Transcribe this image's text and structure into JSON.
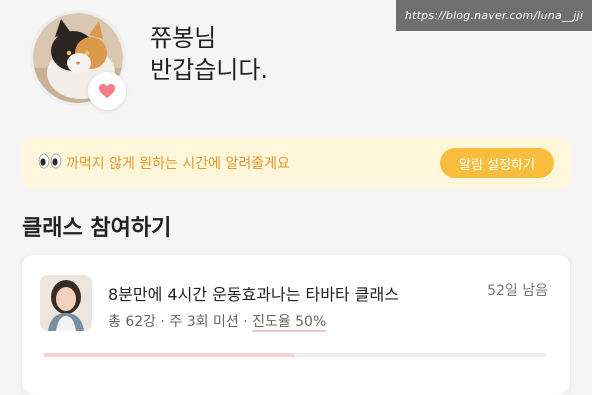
{
  "watermark": "https://blog.naver.com/luna__jji",
  "greeting": {
    "name_line": "쮸봉님",
    "hello_line": "반갑습니다."
  },
  "notice": {
    "text": "까먹지 않게 원하는 시간에 알려줄게요",
    "button_label": "알림 설정하기",
    "icon": "eyes-emoji"
  },
  "section_title": "클래스 참여하기",
  "class_card": {
    "title": "8분만에 4시간 운동효과나는 타바타  클래스",
    "days_left": "52일 남음",
    "meta_prefix": "총 62강 · 주 3회 미션 · ",
    "progress_text": "진도율 50%",
    "progress": 0.5
  },
  "colors": {
    "accent": "#f8bd3c",
    "notice_bg": "#fff6dc",
    "notice_text": "#e6992a",
    "heart": "#f47c86",
    "progress_fill": "#f8d2d2"
  }
}
